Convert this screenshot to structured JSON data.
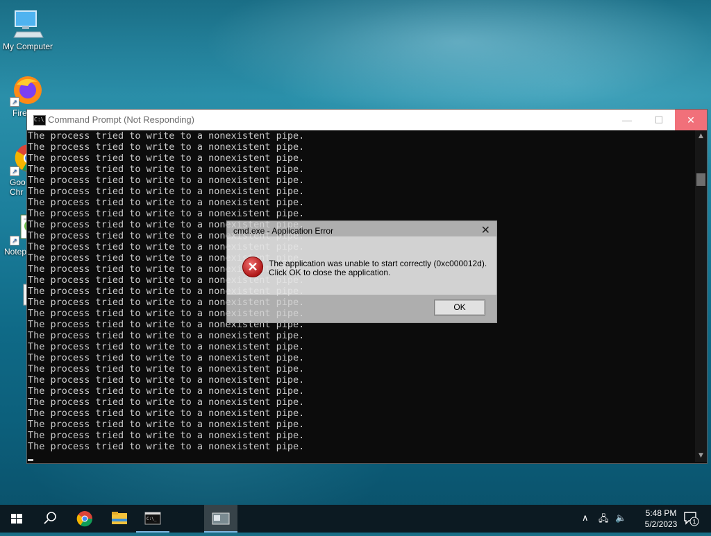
{
  "desktop": {
    "icons": [
      {
        "label": "My Computer",
        "icon": "computer-icon"
      },
      {
        "label": "Fire",
        "icon": "firefox-icon"
      },
      {
        "label": "Goo\nChr",
        "icon": "chrome-icon"
      },
      {
        "label": "Notep",
        "icon": "notepad-icon"
      },
      {
        "label": "",
        "icon": "settings-file-icon"
      }
    ]
  },
  "cmd_window": {
    "title": "Command Prompt (Not Responding)",
    "line_text": "The process tried to write to a nonexistent pipe.",
    "line_count": 29,
    "buttons": {
      "minimize": "—",
      "maximize": "☐",
      "close": "✕"
    }
  },
  "error_dialog": {
    "title": "cmd.exe - Application Error",
    "message_line1": "The application was unable to start correctly (0xc000012d).",
    "message_line2": "Click OK to close the application.",
    "ok_label": "OK",
    "close_glyph": "✕"
  },
  "taskbar": {
    "time": "5:48 PM",
    "date": "5/2/2023",
    "notification_count": "1",
    "pinned": [
      "start-icon",
      "search-icon",
      "chrome-icon",
      "file-explorer-icon",
      "cmd-icon",
      "error-app-icon"
    ]
  },
  "colors": {
    "console_bg": "#0c0c0c",
    "console_text": "#cccccc",
    "close_hover": "#f1707a"
  }
}
